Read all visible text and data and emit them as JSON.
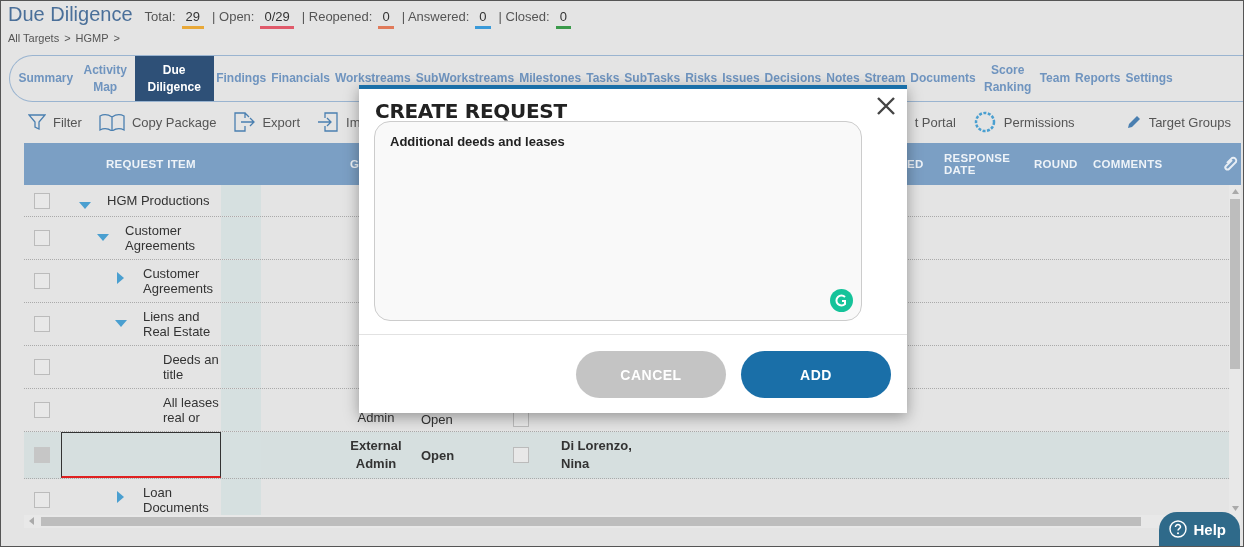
{
  "header": {
    "title": "Due Diligence",
    "stats": [
      {
        "label": "Total:",
        "value": "29",
        "color": "#e8a838"
      },
      {
        "label": "| Open:",
        "value": "0/29",
        "color": "#e05a6a"
      },
      {
        "label": "| Reopened:",
        "value": "0",
        "color": "#e07a5a"
      },
      {
        "label": "| Answered:",
        "value": "0",
        "color": "#3a9ad9"
      },
      {
        "label": "| Closed:",
        "value": "0",
        "color": "#3a9a4a"
      }
    ],
    "breadcrumb": [
      "All Targets",
      ">",
      "HGMP",
      ">"
    ]
  },
  "tabs": [
    {
      "label": "Summary",
      "selected": false
    },
    {
      "label": "Activity Map",
      "selected": false
    },
    {
      "label": "Due Diligence",
      "selected": true
    },
    {
      "label": "Findings",
      "selected": false
    },
    {
      "label": "Financials",
      "selected": false
    },
    {
      "label": "Workstreams",
      "selected": false
    },
    {
      "label": "SubWorkstreams",
      "selected": false
    },
    {
      "label": "Milestones",
      "selected": false
    },
    {
      "label": "Tasks",
      "selected": false
    },
    {
      "label": "SubTasks",
      "selected": false
    },
    {
      "label": "Risks",
      "selected": false
    },
    {
      "label": "Issues",
      "selected": false
    },
    {
      "label": "Decisions",
      "selected": false
    },
    {
      "label": "Notes",
      "selected": false
    },
    {
      "label": "Stream",
      "selected": false
    },
    {
      "label": "Documents",
      "selected": false
    },
    {
      "label": "Score Ranking",
      "selected": false
    },
    {
      "label": "Team",
      "selected": false
    },
    {
      "label": "Reports",
      "selected": false
    },
    {
      "label": "Settings",
      "selected": false
    }
  ],
  "toolbar": [
    "Filter",
    "Copy Package",
    "Export",
    "Im",
    "t Portal",
    "Permissions",
    "Target Groups"
  ],
  "table": {
    "columns": [
      "REQUEST ITEM",
      "G",
      "ED",
      "RESPONSE DATE",
      "ROUND",
      "COMMENTS"
    ],
    "rows": [
      {
        "label": "HGM Productions",
        "kind": "folder",
        "expanded": true,
        "checked": false,
        "disabled": false,
        "selected": false,
        "children": [
          {
            "label": "Customer Agreements",
            "kind": "folder",
            "expanded": true,
            "checked": false,
            "disabled": false,
            "selected": false,
            "children": [
              {
                "label": "Customer Agreements",
                "kind": "folder",
                "expanded": false,
                "checked": false,
                "disabled": false,
                "selected": false
              },
              {
                "label": "Liens and Real Estate",
                "kind": "folder",
                "expanded": true,
                "checked": false,
                "disabled": false,
                "selected": false,
                "children": [
                  {
                    "label": "Deeds an\ntitle",
                    "kind": "item",
                    "checked": false,
                    "disabled": false,
                    "selected": false
                  },
                  {
                    "label": "All leases\nreal or",
                    "kind": "item",
                    "checked": false,
                    "disabled": false,
                    "selected": false,
                    "group": "Admin",
                    "status": "Open",
                    "flagged": false
                  },
                  {
                    "kind": "editor",
                    "checked": false,
                    "disabled": true,
                    "selected": true,
                    "group": "External Admin",
                    "status": "Open",
                    "flagged": false,
                    "assignee": "Di Lorenzo, Nina"
                  }
                ]
              },
              {
                "label": "Loan Documents",
                "kind": "folder",
                "expanded": false,
                "checked": false,
                "disabled": false,
                "selected": false
              }
            ]
          }
        ]
      }
    ]
  },
  "dialog": {
    "title": "CREATE REQUEST",
    "value": "Additional deeds and leases",
    "buttons": [
      {
        "label": "CANCEL",
        "kind": "secondary"
      },
      {
        "label": "ADD",
        "kind": "primary"
      }
    ]
  },
  "help": "Help"
}
